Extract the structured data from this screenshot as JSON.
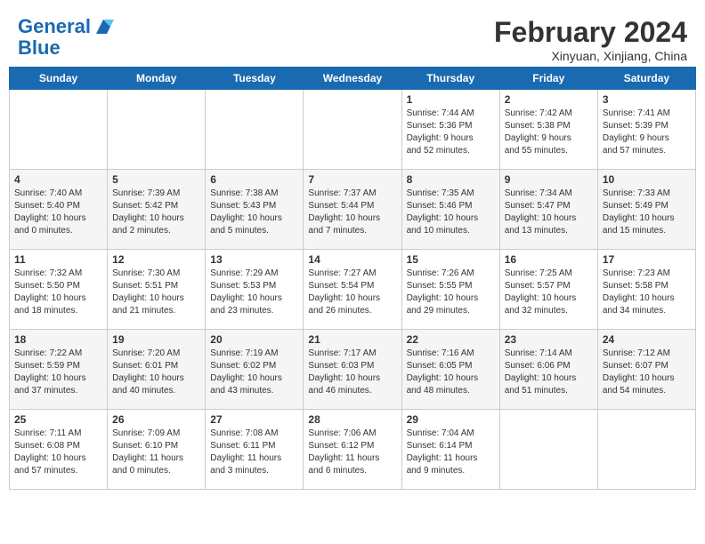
{
  "header": {
    "logo_line1": "General",
    "logo_line2": "Blue",
    "title": "February 2024",
    "subtitle": "Xinyuan, Xinjiang, China"
  },
  "weekdays": [
    "Sunday",
    "Monday",
    "Tuesday",
    "Wednesday",
    "Thursday",
    "Friday",
    "Saturday"
  ],
  "weeks": [
    [
      {
        "day": "",
        "info": ""
      },
      {
        "day": "",
        "info": ""
      },
      {
        "day": "",
        "info": ""
      },
      {
        "day": "",
        "info": ""
      },
      {
        "day": "1",
        "info": "Sunrise: 7:44 AM\nSunset: 5:36 PM\nDaylight: 9 hours\nand 52 minutes."
      },
      {
        "day": "2",
        "info": "Sunrise: 7:42 AM\nSunset: 5:38 PM\nDaylight: 9 hours\nand 55 minutes."
      },
      {
        "day": "3",
        "info": "Sunrise: 7:41 AM\nSunset: 5:39 PM\nDaylight: 9 hours\nand 57 minutes."
      }
    ],
    [
      {
        "day": "4",
        "info": "Sunrise: 7:40 AM\nSunset: 5:40 PM\nDaylight: 10 hours\nand 0 minutes."
      },
      {
        "day": "5",
        "info": "Sunrise: 7:39 AM\nSunset: 5:42 PM\nDaylight: 10 hours\nand 2 minutes."
      },
      {
        "day": "6",
        "info": "Sunrise: 7:38 AM\nSunset: 5:43 PM\nDaylight: 10 hours\nand 5 minutes."
      },
      {
        "day": "7",
        "info": "Sunrise: 7:37 AM\nSunset: 5:44 PM\nDaylight: 10 hours\nand 7 minutes."
      },
      {
        "day": "8",
        "info": "Sunrise: 7:35 AM\nSunset: 5:46 PM\nDaylight: 10 hours\nand 10 minutes."
      },
      {
        "day": "9",
        "info": "Sunrise: 7:34 AM\nSunset: 5:47 PM\nDaylight: 10 hours\nand 13 minutes."
      },
      {
        "day": "10",
        "info": "Sunrise: 7:33 AM\nSunset: 5:49 PM\nDaylight: 10 hours\nand 15 minutes."
      }
    ],
    [
      {
        "day": "11",
        "info": "Sunrise: 7:32 AM\nSunset: 5:50 PM\nDaylight: 10 hours\nand 18 minutes."
      },
      {
        "day": "12",
        "info": "Sunrise: 7:30 AM\nSunset: 5:51 PM\nDaylight: 10 hours\nand 21 minutes."
      },
      {
        "day": "13",
        "info": "Sunrise: 7:29 AM\nSunset: 5:53 PM\nDaylight: 10 hours\nand 23 minutes."
      },
      {
        "day": "14",
        "info": "Sunrise: 7:27 AM\nSunset: 5:54 PM\nDaylight: 10 hours\nand 26 minutes."
      },
      {
        "day": "15",
        "info": "Sunrise: 7:26 AM\nSunset: 5:55 PM\nDaylight: 10 hours\nand 29 minutes."
      },
      {
        "day": "16",
        "info": "Sunrise: 7:25 AM\nSunset: 5:57 PM\nDaylight: 10 hours\nand 32 minutes."
      },
      {
        "day": "17",
        "info": "Sunrise: 7:23 AM\nSunset: 5:58 PM\nDaylight: 10 hours\nand 34 minutes."
      }
    ],
    [
      {
        "day": "18",
        "info": "Sunrise: 7:22 AM\nSunset: 5:59 PM\nDaylight: 10 hours\nand 37 minutes."
      },
      {
        "day": "19",
        "info": "Sunrise: 7:20 AM\nSunset: 6:01 PM\nDaylight: 10 hours\nand 40 minutes."
      },
      {
        "day": "20",
        "info": "Sunrise: 7:19 AM\nSunset: 6:02 PM\nDaylight: 10 hours\nand 43 minutes."
      },
      {
        "day": "21",
        "info": "Sunrise: 7:17 AM\nSunset: 6:03 PM\nDaylight: 10 hours\nand 46 minutes."
      },
      {
        "day": "22",
        "info": "Sunrise: 7:16 AM\nSunset: 6:05 PM\nDaylight: 10 hours\nand 48 minutes."
      },
      {
        "day": "23",
        "info": "Sunrise: 7:14 AM\nSunset: 6:06 PM\nDaylight: 10 hours\nand 51 minutes."
      },
      {
        "day": "24",
        "info": "Sunrise: 7:12 AM\nSunset: 6:07 PM\nDaylight: 10 hours\nand 54 minutes."
      }
    ],
    [
      {
        "day": "25",
        "info": "Sunrise: 7:11 AM\nSunset: 6:08 PM\nDaylight: 10 hours\nand 57 minutes."
      },
      {
        "day": "26",
        "info": "Sunrise: 7:09 AM\nSunset: 6:10 PM\nDaylight: 11 hours\nand 0 minutes."
      },
      {
        "day": "27",
        "info": "Sunrise: 7:08 AM\nSunset: 6:11 PM\nDaylight: 11 hours\nand 3 minutes."
      },
      {
        "day": "28",
        "info": "Sunrise: 7:06 AM\nSunset: 6:12 PM\nDaylight: 11 hours\nand 6 minutes."
      },
      {
        "day": "29",
        "info": "Sunrise: 7:04 AM\nSunset: 6:14 PM\nDaylight: 11 hours\nand 9 minutes."
      },
      {
        "day": "",
        "info": ""
      },
      {
        "day": "",
        "info": ""
      }
    ]
  ]
}
